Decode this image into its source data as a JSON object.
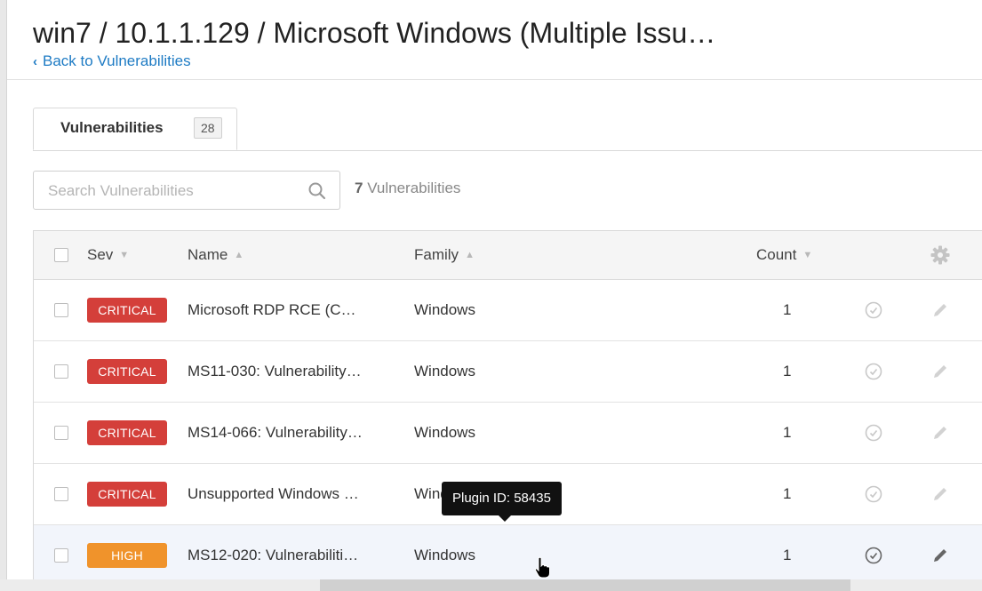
{
  "header": {
    "title": "win7 / 10.1.1.129 / Microsoft Windows (Multiple Issu…",
    "back_label": "Back to Vulnerabilities"
  },
  "tab": {
    "label": "Vulnerabilities",
    "count": "28"
  },
  "search": {
    "placeholder": "Search Vulnerabilities",
    "value": ""
  },
  "result_count": {
    "number": "7",
    "label": "Vulnerabilities"
  },
  "table": {
    "columns": {
      "sev": "Sev",
      "name": "Name",
      "family": "Family",
      "count": "Count"
    },
    "rows": [
      {
        "sev": "CRITICAL",
        "sev_color": "#d43f3a",
        "name": "Microsoft RDP RCE (C…",
        "family": "Windows",
        "count": "1"
      },
      {
        "sev": "CRITICAL",
        "sev_color": "#d43f3a",
        "name": "MS11-030: Vulnerability…",
        "family": "Windows",
        "count": "1"
      },
      {
        "sev": "CRITICAL",
        "sev_color": "#d43f3a",
        "name": "MS14-066: Vulnerability…",
        "family": "Windows",
        "count": "1"
      },
      {
        "sev": "CRITICAL",
        "sev_color": "#d43f3a",
        "name": "Unsupported Windows …",
        "family": "Windows",
        "count": "1"
      },
      {
        "sev": "HIGH",
        "sev_color": "#f0932b",
        "name": "MS12-020: Vulnerabiliti…",
        "family": "Windows",
        "count": "1"
      }
    ]
  },
  "tooltip": {
    "text": "Plugin ID: 58435"
  },
  "colors": {
    "link": "#1e7bc4",
    "critical": "#d43f3a",
    "high": "#f0932b"
  }
}
